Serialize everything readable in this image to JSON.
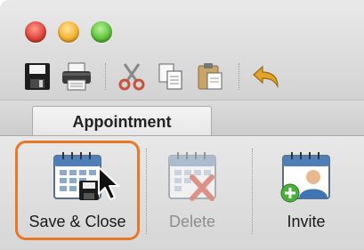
{
  "window": {
    "traffic_lights": [
      "close",
      "minimize",
      "zoom"
    ]
  },
  "quick_access_toolbar": {
    "icons": [
      "save-icon",
      "print-icon",
      "cut-icon",
      "copy-icon",
      "paste-icon",
      "undo-icon"
    ]
  },
  "tabs": [
    {
      "label": "Appointment",
      "selected": true
    }
  ],
  "ribbon": {
    "save_close_label": "Save & Close",
    "delete_label": "Delete",
    "invite_label": "Invite",
    "highlight_color": "#e8772a"
  }
}
